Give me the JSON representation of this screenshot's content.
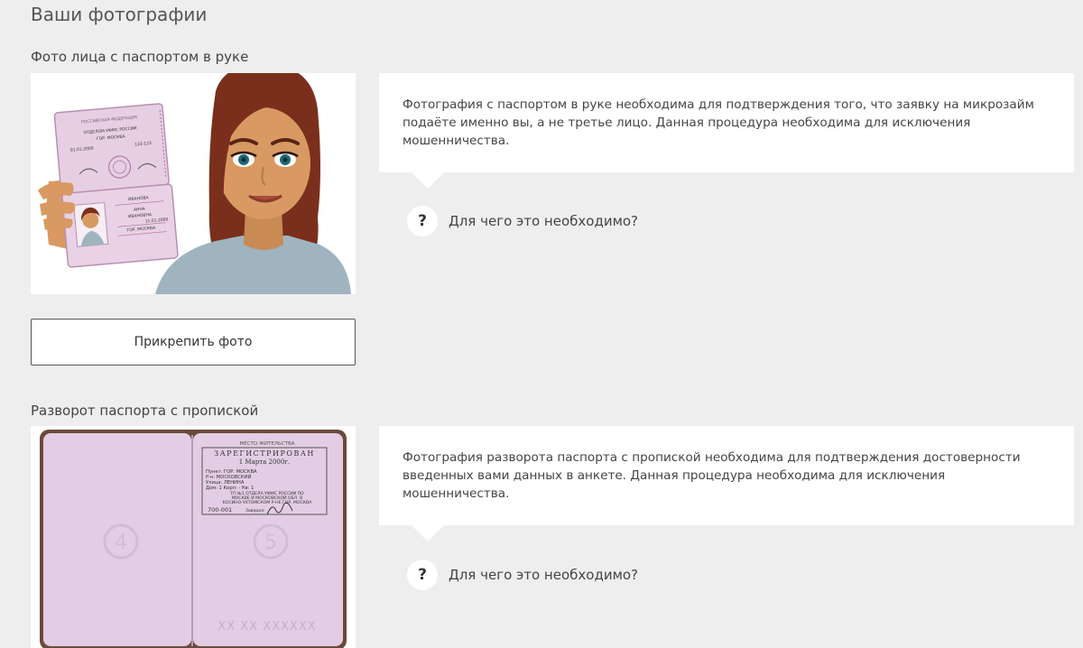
{
  "page": {
    "title": "Ваши фотографии"
  },
  "sections": [
    {
      "title": "Фото лица с паспортом в руке",
      "info_text": "Фотография с паспортом в руке необходима для подтверждения того, что заявку на микрозайм подаёте именно вы, а не третье лицо. Данная процедура необходима для исключения мошенничества.",
      "help_icon": "?",
      "help_text": "Для чего это необходимо?",
      "attach_label": "Прикрепить фото",
      "image": {
        "type": "woman-holding-passport-illustration",
        "passport_header": "РОССИЙСКАЯ ФЕДЕРАЦИЯ",
        "issued_by": "ОТДЕЛОМ УФМС РОССИИ",
        "issued_city": "ГОР. МОСКВА",
        "issue_date": "01.01.2000",
        "code": "123-123",
        "surname": "ИВАНОВА",
        "name": "АННА",
        "patronymic": "ИВАНОВНА",
        "birth_date": "11.01.2000",
        "birth_place": "ГОР. МОСКВА"
      }
    },
    {
      "title": "Разворот паспорта с пропиской",
      "info_text": "Фотография разворота паспорта с пропиской необходима для подтверждения достоверности введенных вами данных в анкете. Данная процедура необходима для исключения мошенничества.",
      "help_icon": "?",
      "help_text": "Для чего это необходимо?",
      "image": {
        "type": "passport-registration-spread",
        "stamp_header": "МЕСТО ЖИТЕЛЬСТВА",
        "stamp_title": "ЗАРЕГИСТРИРОВАН",
        "stamp_date": "1 Марта 2000г.",
        "line_punkt": "Пункт:  ГОР. МОСКВА",
        "line_rn": "Р-н:  МОСКОВСКИЙ",
        "line_street": "Улица:  ЛЕНИНА",
        "line_house": "Дом:  1   Корп:  -   Кв: 1",
        "line_office1": "ТП №1 ОТДЕЛА УФМС РОССИИ ПО",
        "line_office2": "МОСКВЕ И МОСКОВСКОЙ ОБЛ. В",
        "line_office3": "КОСИНО-УХТОМСКОМ Р-НЕ ГОР. МОСКВА",
        "code": "700-001",
        "signature_label": "Заверил:",
        "page_left": "4",
        "page_right": "5",
        "serial": "XX XX XXXXXX"
      }
    }
  ]
}
